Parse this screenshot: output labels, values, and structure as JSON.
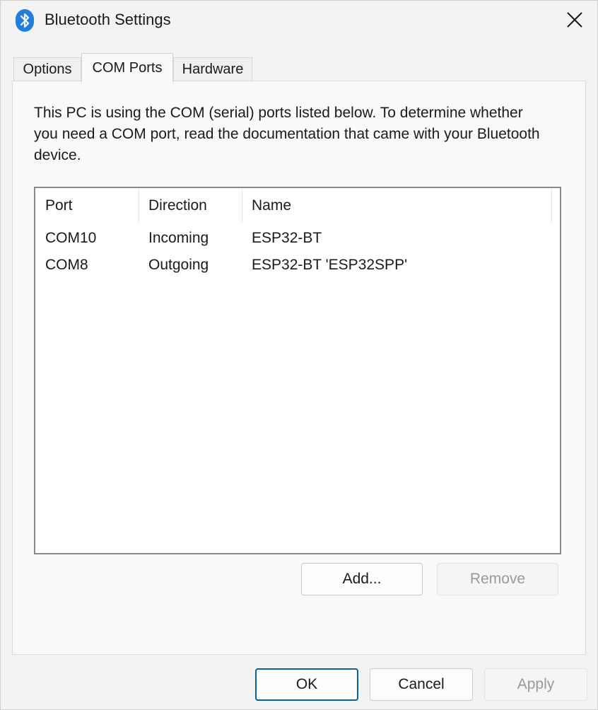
{
  "window": {
    "title": "Bluetooth Settings",
    "accent_color": "#0063b1"
  },
  "icons": {
    "app": "bluetooth-icon",
    "close": "close-icon"
  },
  "tabs": [
    {
      "label": "Options",
      "active": false
    },
    {
      "label": "COM Ports",
      "active": true
    },
    {
      "label": "Hardware",
      "active": false
    }
  ],
  "com_ports": {
    "description": "This PC is using the COM (serial) ports listed below. To determine whether you need a COM port, read the documentation that came with your Bluetooth device.",
    "columns": [
      "Port",
      "Direction",
      "Name"
    ],
    "rows": [
      {
        "port": "COM10",
        "direction": "Incoming",
        "name": "ESP32-BT"
      },
      {
        "port": "COM8",
        "direction": "Outgoing",
        "name": "ESP32-BT 'ESP32SPP'"
      }
    ],
    "add_label": "Add...",
    "remove_label": "Remove"
  },
  "footer": {
    "ok_label": "OK",
    "cancel_label": "Cancel",
    "apply_label": "Apply"
  }
}
